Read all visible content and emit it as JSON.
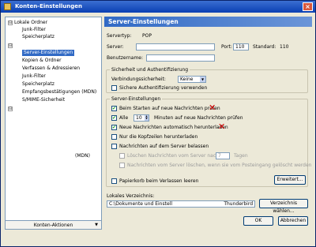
{
  "window": {
    "title": "Konten-Einstellungen",
    "close_glyph": "×"
  },
  "tree": {
    "nodes": [
      {
        "text": "Lokale Ordner",
        "toggle": "⊟"
      },
      {
        "text": "Junk-Filter"
      },
      {
        "text": "Speicherplatz"
      },
      {
        "text": "Server-Einstellungen"
      },
      {
        "text": "Kopien & Ordner"
      },
      {
        "text": "Verfassen & Adressieren"
      },
      {
        "text": "Junk-Filter"
      },
      {
        "text": "Speicherplatz"
      },
      {
        "text": "Empfangsbestätigungen (MDN)"
      },
      {
        "text": "S/MIME-Sicherheit"
      },
      {
        "text": "(MDN)"
      }
    ],
    "accounts_button": "Konten-Aktionen",
    "accounts_arrow": "▼"
  },
  "panel": {
    "header": "Server-Einstellungen",
    "server_type_label": "Servertyp:",
    "server_type_value": "POP",
    "server_label": "Server:",
    "server_value": "",
    "port_label": "Port:",
    "port_value": "110",
    "standard_label": "Standard:",
    "standard_value": "110",
    "username_label": "Benutzername:",
    "username_value": "",
    "security": {
      "title": "Sicherheit und Authentifizierung",
      "conn_label": "Verbindungssicherheit:",
      "conn_value": "Keine",
      "secure_auth": "Sichere Authentifizierung verwenden"
    },
    "settings": {
      "title": "Server-Einstellungen",
      "check_start": "Beim Starten auf neue Nachrichten prüfen",
      "every_label": "Alle",
      "every_value": "10",
      "minutes_label": "Minuten auf neue Nachrichten prüfen",
      "auto_download": "Neue Nachrichten automatisch herunterladen",
      "headers_only": "Nur die Kopfzeilen herunterladen",
      "leave_on_server": "Nachrichten auf dem Server belassen",
      "delete_after": "Löschen Nachrichten vom Server nach",
      "days_value": "7",
      "days_label": "Tagen",
      "delete_when": "Nachrichten vom Server löschen, wenn sie vom Posteingang gelöscht werden",
      "empty_trash": "Papierkorb beim Verlassen leeren",
      "advanced_button": "Erweitert..."
    },
    "local_dir_label": "Lokales Verzeichnis:",
    "local_dir_value": "C:\\Dokumente und Einstell",
    "local_dir_tail": "Thunderbird",
    "choose_dir_button": "Verzeichnis wählen...",
    "ok_button": "OK",
    "cancel_button": "Abbrechen"
  },
  "glyphs": {
    "check": "✔",
    "cross": "✕",
    "arrow_down": "▼",
    "spin_up": "▲",
    "spin_down": "▼"
  }
}
